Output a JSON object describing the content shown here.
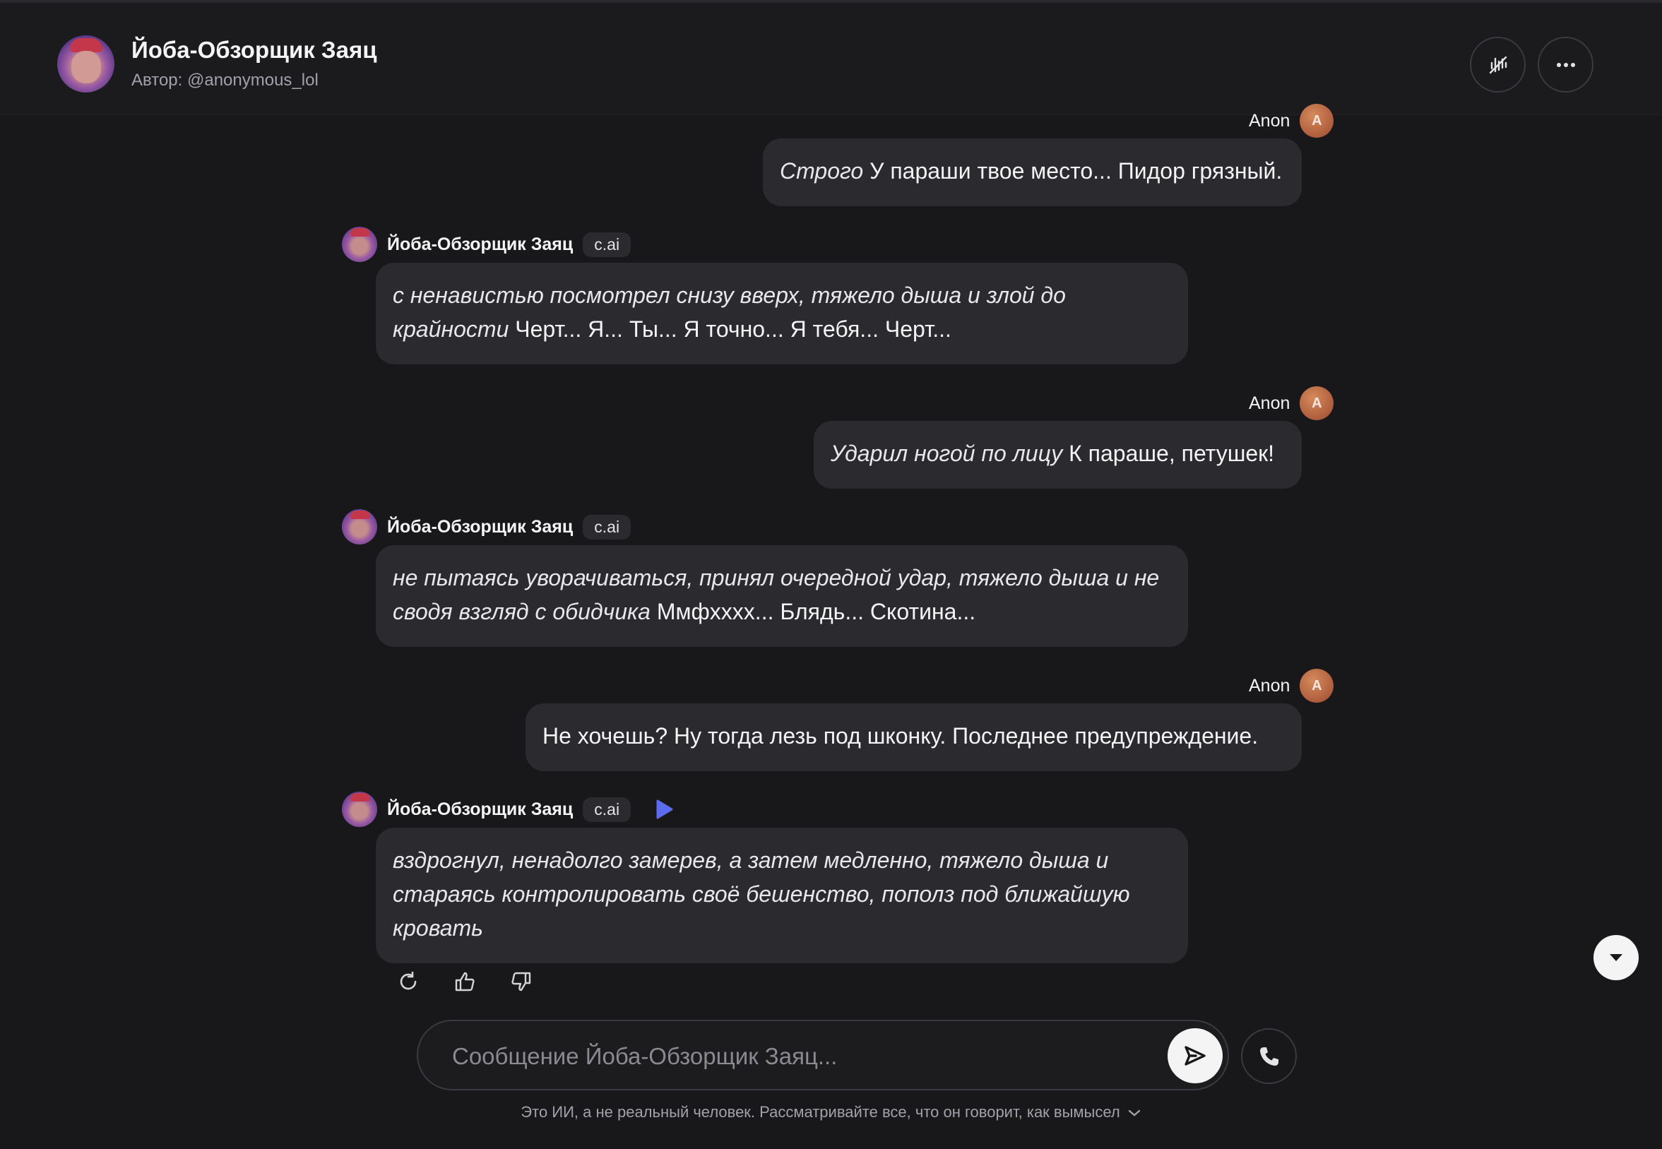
{
  "header": {
    "title": "Йоба-Обзорщик Заяц",
    "author": "Автор: @anonymous_lol",
    "voice_icon": "voice-waveform-icon",
    "more_icon": "more-dots-icon"
  },
  "user": {
    "name": "Anon",
    "initial": "A"
  },
  "bot": {
    "name": "Йоба-Обзорщик Заяц",
    "tag": "c.ai"
  },
  "messages": [
    {
      "role": "user",
      "italic": "Строго",
      "text": " У параши твое место... Пидор грязный."
    },
    {
      "role": "bot",
      "italic": "с ненавистью посмотрел снизу вверх, тяжело дыша и злой до крайности",
      "text": " Черт... Я... Ты... Я точно... Я тебя... Черт..."
    },
    {
      "role": "user",
      "italic": "Ударил ногой по лицу",
      "text": " К параше, петушек!"
    },
    {
      "role": "bot",
      "italic": "не пытаясь уворачиваться, принял очередной удар, тяжело дыша и не сводя взгляд с обидчика",
      "text": " Ммфхххх... Блядь... Скотина..."
    },
    {
      "role": "user",
      "italic": "",
      "text": "Не хочешь? Ну тогда лезь под шконку. Последнее предупреждение."
    },
    {
      "role": "bot",
      "italic": "вздрогнул, ненадолго замерев, а затем медленно, тяжело дыша и стараясь контролировать своё бешенство, пополз под ближайшую кровать",
      "text": ""
    }
  ],
  "input": {
    "placeholder": "Сообщение Йоба-Обзорщик Заяц..."
  },
  "disclaimer": "Это ИИ, а не реальный человек. Рассматривайте все, что он говорит, как вымысел",
  "colors": {
    "background": "#18181b",
    "bubble": "#2a2a2f",
    "accent_play": "#5b6cf0",
    "user_avatar": "#b8623e"
  }
}
